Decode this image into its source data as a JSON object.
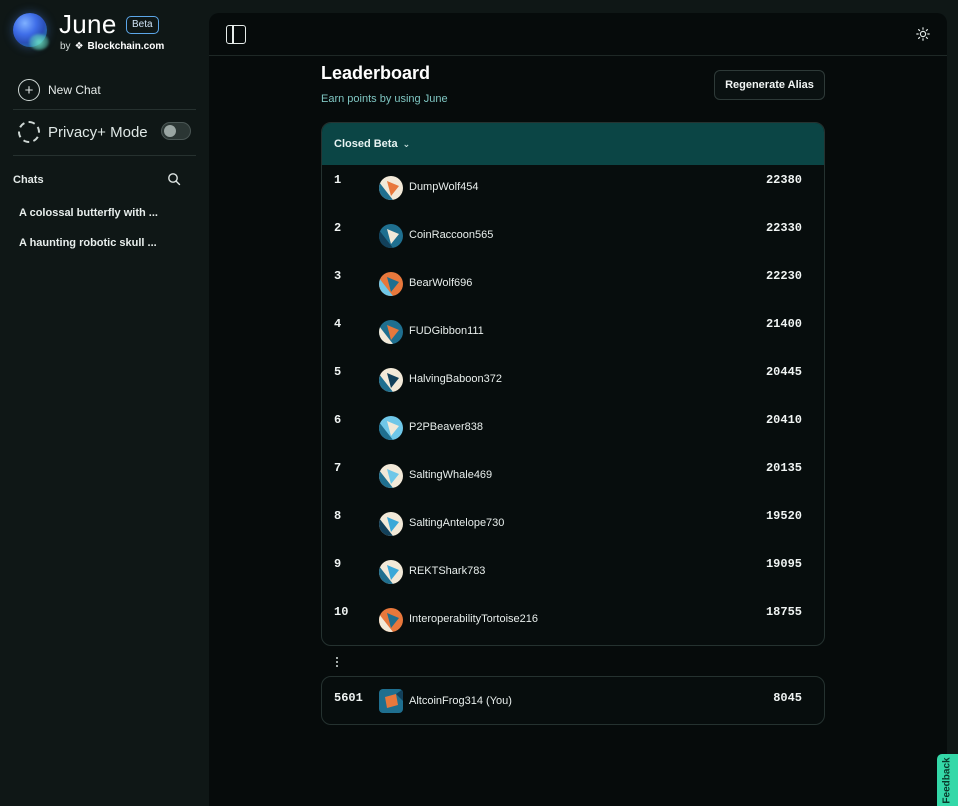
{
  "brand": {
    "name": "June",
    "badge": "Beta",
    "by": "by",
    "company": "Blockchain.com"
  },
  "sidebar": {
    "new_chat": "New Chat",
    "privacy_mode": "Privacy+ Mode",
    "privacy_enabled": false,
    "chats_header": "Chats",
    "chats": [
      "A colossal butterfly with ...",
      "A haunting robotic skull ..."
    ]
  },
  "leaderboard": {
    "title": "Leaderboard",
    "subtitle": "Earn points by using June",
    "regenerate_label": "Regenerate Alias",
    "filter_label": "Closed Beta",
    "rows": [
      {
        "rank": "1",
        "alias": "DumpWolf454",
        "score": "22380"
      },
      {
        "rank": "2",
        "alias": "CoinRaccoon565",
        "score": "22330"
      },
      {
        "rank": "3",
        "alias": "BearWolf696",
        "score": "22230"
      },
      {
        "rank": "4",
        "alias": "FUDGibbon111",
        "score": "21400"
      },
      {
        "rank": "5",
        "alias": "HalvingBaboon372",
        "score": "20445"
      },
      {
        "rank": "6",
        "alias": "P2PBeaver838",
        "score": "20410"
      },
      {
        "rank": "7",
        "alias": "SaltingWhale469",
        "score": "20135"
      },
      {
        "rank": "8",
        "alias": "SaltingAntelope730",
        "score": "19520"
      },
      {
        "rank": "9",
        "alias": "REKTShark783",
        "score": "19095"
      },
      {
        "rank": "10",
        "alias": "InteroperabilityTortoise216",
        "score": "18755"
      }
    ],
    "you": {
      "rank": "5601",
      "alias": "AltcoinFrog314 (You)",
      "score": "8045"
    }
  },
  "feedback_label": "Feedback",
  "colors": {
    "accent_header": "#0b4545",
    "feedback": "#34d8a8",
    "subtitle": "#7fc6c2"
  }
}
